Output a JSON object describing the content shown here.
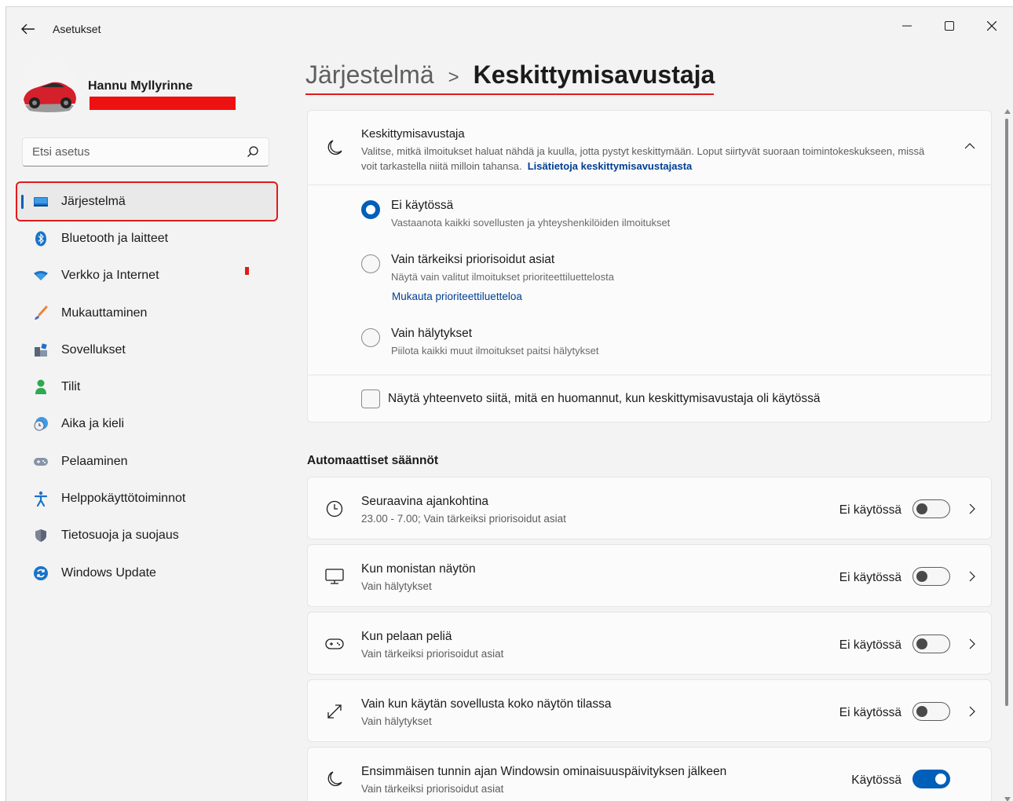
{
  "app": {
    "title": "Asetukset"
  },
  "user": {
    "name": "Hannu Myllyrinne"
  },
  "search": {
    "placeholder": "Etsi asetus"
  },
  "sidebar": {
    "items": [
      {
        "label": "Järjestelmä",
        "icon": "monitor-icon",
        "active": true
      },
      {
        "label": "Bluetooth ja laitteet",
        "icon": "bluetooth-icon"
      },
      {
        "label": "Verkko ja Internet",
        "icon": "wifi-icon"
      },
      {
        "label": "Mukauttaminen",
        "icon": "brush-icon"
      },
      {
        "label": "Sovellukset",
        "icon": "apps-icon"
      },
      {
        "label": "Tilit",
        "icon": "person-icon"
      },
      {
        "label": "Aika ja kieli",
        "icon": "globe-clock-icon"
      },
      {
        "label": "Pelaaminen",
        "icon": "gamepad-icon"
      },
      {
        "label": "Helppokäyttötoiminnot",
        "icon": "accessibility-icon"
      },
      {
        "label": "Tietosuoja ja suojaus",
        "icon": "shield-icon"
      },
      {
        "label": "Windows Update",
        "icon": "update-icon"
      }
    ]
  },
  "breadcrumb": {
    "parent": "Järjestelmä",
    "separator": ">",
    "current": "Keskittymisavustaja"
  },
  "focus": {
    "title": "Keskittymisavustaja",
    "description": "Valitse, mitkä ilmoitukset haluat nähdä ja kuulla, jotta pystyt keskittymään. Loput siirtyvät suoraan toimintokeskukseen, missä voit tarkastella niitä milloin tahansa.",
    "learn_more": "Lisätietoja keskittymisavustajasta",
    "options": [
      {
        "title": "Ei käytössä",
        "desc": "Vastaanota kaikki sovellusten ja yhteyshenkilöiden ilmoitukset",
        "checked": true
      },
      {
        "title": "Vain tärkeiksi priorisoidut asiat",
        "desc": "Näytä vain valitut ilmoitukset prioriteettiluettelosta",
        "link": "Mukauta prioriteettiluetteloa",
        "checked": false
      },
      {
        "title": "Vain hälytykset",
        "desc": "Piilota kaikki muut ilmoitukset paitsi hälytykset",
        "checked": false
      }
    ],
    "summary_checkbox": "Näytä yhteenveto siitä, mitä en huomannut, kun keskittymisavustaja oli käytössä"
  },
  "rules_title": "Automaattiset säännöt",
  "rules": [
    {
      "title": "Seuraavina ajankohtina",
      "sub": "23.00 - 7.00; Vain tärkeiksi priorisoidut asiat",
      "state": "Ei käytössä",
      "on": false,
      "icon": "clock-icon"
    },
    {
      "title": "Kun monistan näytön",
      "sub": "Vain hälytykset",
      "state": "Ei käytössä",
      "on": false,
      "icon": "display-icon"
    },
    {
      "title": "Kun pelaan peliä",
      "sub": "Vain tärkeiksi priorisoidut asiat",
      "state": "Ei käytössä",
      "on": false,
      "icon": "gamepad-icon"
    },
    {
      "title": "Vain kun käytän sovellusta koko näytön tilassa",
      "sub": "Vain hälytykset",
      "state": "Ei käytössä",
      "on": false,
      "icon": "fullscreen-icon"
    },
    {
      "title": "Ensimmäisen tunnin ajan Windowsin ominaisuuspäivityksen jälkeen",
      "sub": "Vain tärkeiksi priorisoidut asiat",
      "state": "Käytössä",
      "on": true,
      "icon": "moon-icon"
    }
  ],
  "colors": {
    "accent": "#005fb8",
    "highlight": "#e01b1b",
    "link": "#003e92"
  }
}
